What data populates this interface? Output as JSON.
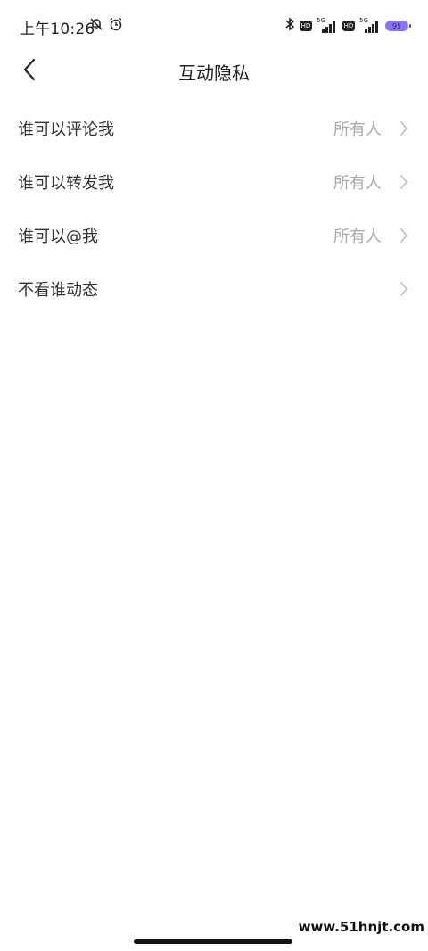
{
  "status_bar": {
    "time": "上午10:26",
    "net1": "5G",
    "net2": "5G",
    "hd": "HD",
    "battery": "95"
  },
  "header": {
    "title": "互动隐私"
  },
  "list": {
    "items": [
      {
        "label": "谁可以评论我",
        "value": "所有人"
      },
      {
        "label": "谁可以转发我",
        "value": "所有人"
      },
      {
        "label": "谁可以@我",
        "value": "所有人"
      },
      {
        "label": "不看谁动态",
        "value": ""
      }
    ]
  },
  "watermark": "www.51hnjt.com",
  "icons": {
    "back": "chevron-left-icon",
    "row_arrow": "chevron-right-icon",
    "mute": "bell-off-icon",
    "alarm": "alarm-icon",
    "bluetooth": "bluetooth-icon",
    "battery": "battery-icon"
  },
  "colors": {
    "text_primary": "#333333",
    "text_secondary": "#a9a9a9",
    "battery": "#8a73ff"
  }
}
